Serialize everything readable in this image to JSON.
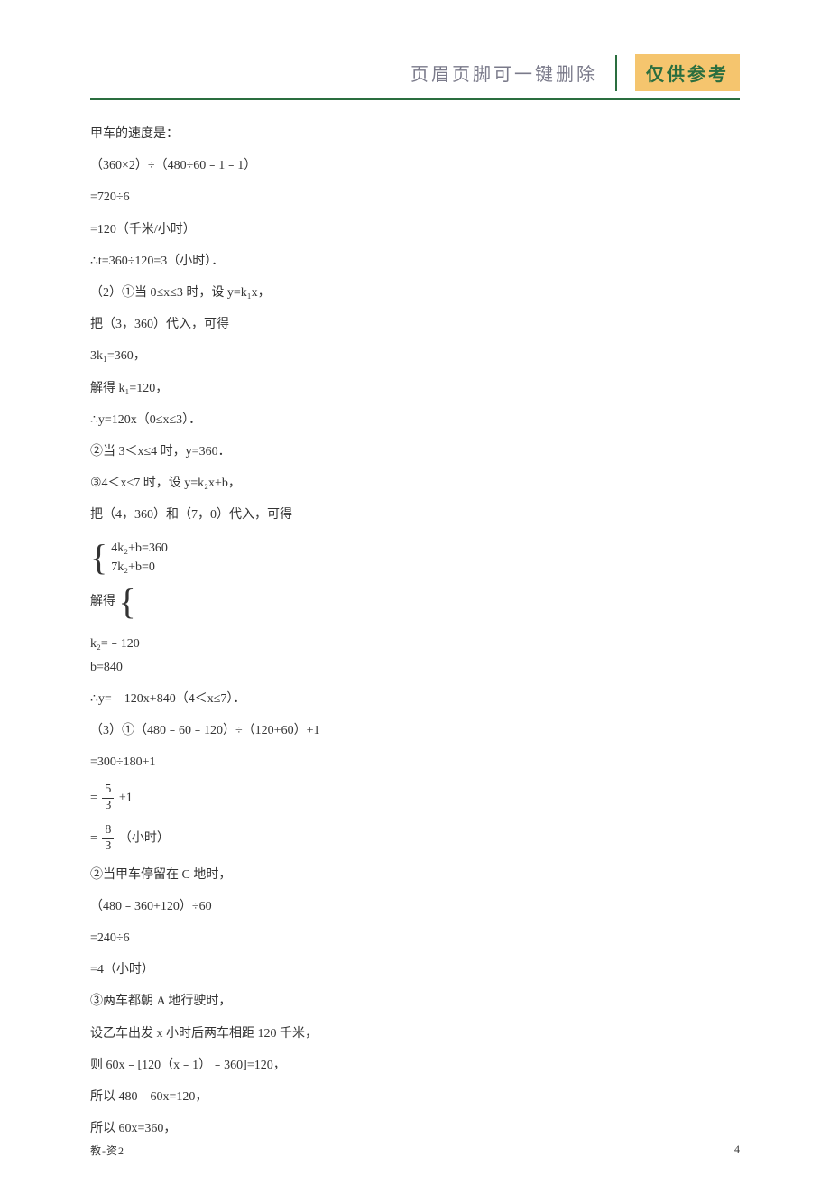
{
  "header": {
    "header_text": "页眉页脚可一键删除",
    "badge_text": "仅供参考"
  },
  "content": {
    "lines": [
      "甲车的速度是：",
      "（360×2）÷（480÷60﹣1﹣1）",
      "=720÷6",
      "=120（千米/小时）",
      "∴t=360÷120=3（小时）．",
      "（2）①当 0≤x≤3 时，设 y=k₁x，",
      "把（3，360）代入，可得",
      "3k₁=360，",
      "解得 k₁=120，",
      "∴y=120x（0≤x≤3）．",
      "②当 3＜x≤4 时，y=360．",
      "③4＜x≤7 时，设 y=k₂x+b，",
      "把（4，360）和（7，0）代入，可得"
    ],
    "system1": {
      "eq1": "4k₂+b=360",
      "eq2": "7k₂+b=0"
    },
    "solve_prefix": "解得",
    "system2": {
      "eq1": "k₂=﹣120",
      "eq2": "b=840"
    },
    "lines2": [
      "∴y=﹣120x+840（4＜x≤7）．",
      "（3）①（480﹣60﹣120）÷（120+60）+1",
      "=300÷180+1"
    ],
    "frac1_prefix": "=",
    "frac1": {
      "num": "5",
      "den": "3"
    },
    "frac1_suffix": "+1",
    "frac2_prefix": "=",
    "frac2": {
      "num": "8",
      "den": "3"
    },
    "frac2_suffix": "（小时）",
    "lines3": [
      "②当甲车停留在 C 地时，",
      "（480﹣360+120）÷60",
      "=240÷6",
      "=4（小时）",
      "③两车都朝 A 地行驶时，",
      "设乙车出发 x 小时后两车相距 120 千米，",
      "则 60x﹣[120（x﹣1）﹣360]=120，",
      "所以 480﹣60x=120，",
      "所以 60x=360，"
    ]
  },
  "footer": {
    "left": "教-资2",
    "right": "4"
  }
}
